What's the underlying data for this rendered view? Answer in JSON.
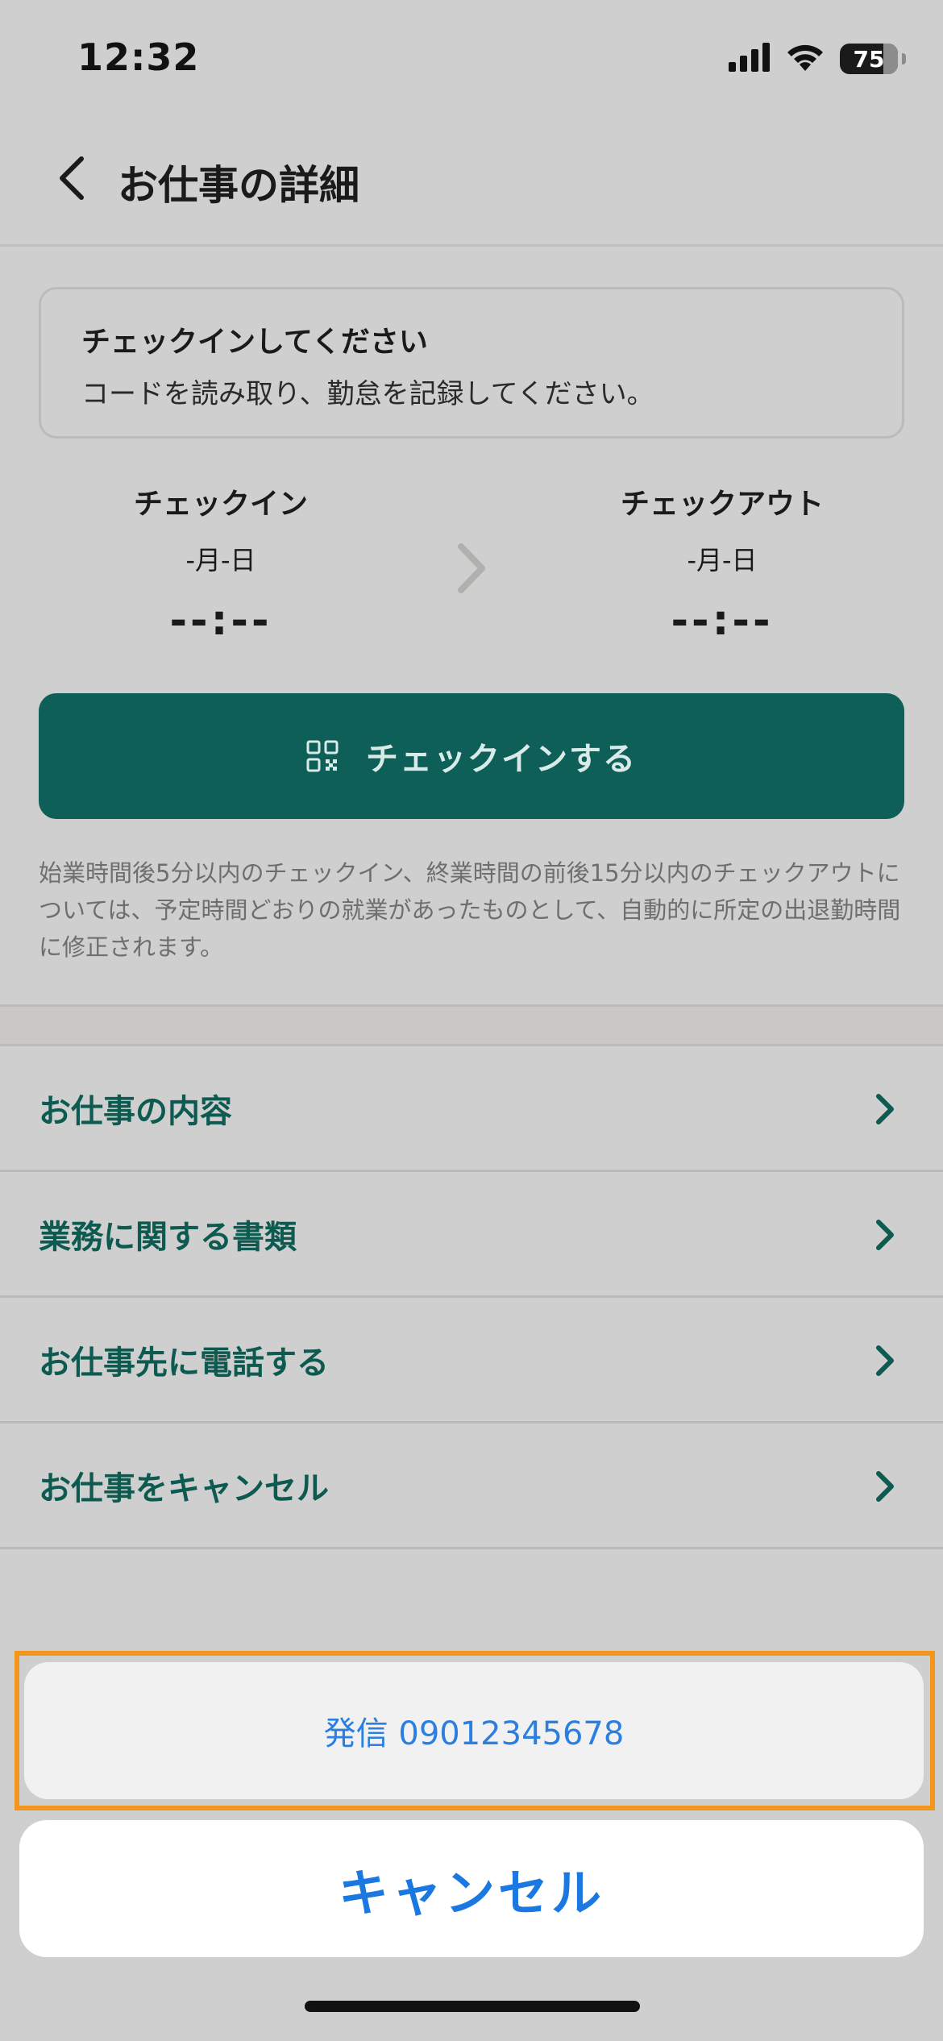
{
  "status_bar": {
    "time": "12:32",
    "battery": "75",
    "icons": [
      "cellular-signal-icon",
      "wifi-icon",
      "battery-icon"
    ]
  },
  "header": {
    "title": "お仕事の詳細",
    "back_icon": "chevron-left-icon"
  },
  "notice": {
    "title": "チェックインしてください",
    "body": "コードを読み取り、勤怠を記録してください。"
  },
  "check_in": {
    "label": "チェックイン",
    "date": "-月-日",
    "time": "--:--"
  },
  "check_out": {
    "label": "チェックアウト",
    "date": "-月-日",
    "time": "--:--"
  },
  "checkin_button": {
    "label": "チェックインする",
    "icon": "qr-code-icon"
  },
  "note": "始業時間後5分以内のチェックイン、終業時間の前後15分以内のチェックアウトについては、予定時間どおりの就業があったものとして、自動的に所定の出退勤時間に修正されます。",
  "menu": {
    "items": [
      {
        "label": "お仕事の内容"
      },
      {
        "label": "業務に関する書類"
      },
      {
        "label": "お仕事先に電話する"
      },
      {
        "label": "お仕事をキャンセル"
      }
    ]
  },
  "action_sheet": {
    "call_label": "発信 09012345678",
    "cancel_label": "キャンセル"
  },
  "colors": {
    "accent": "#0d5f58",
    "link_blue": "#1a78e0",
    "highlight": "#f5961c"
  }
}
